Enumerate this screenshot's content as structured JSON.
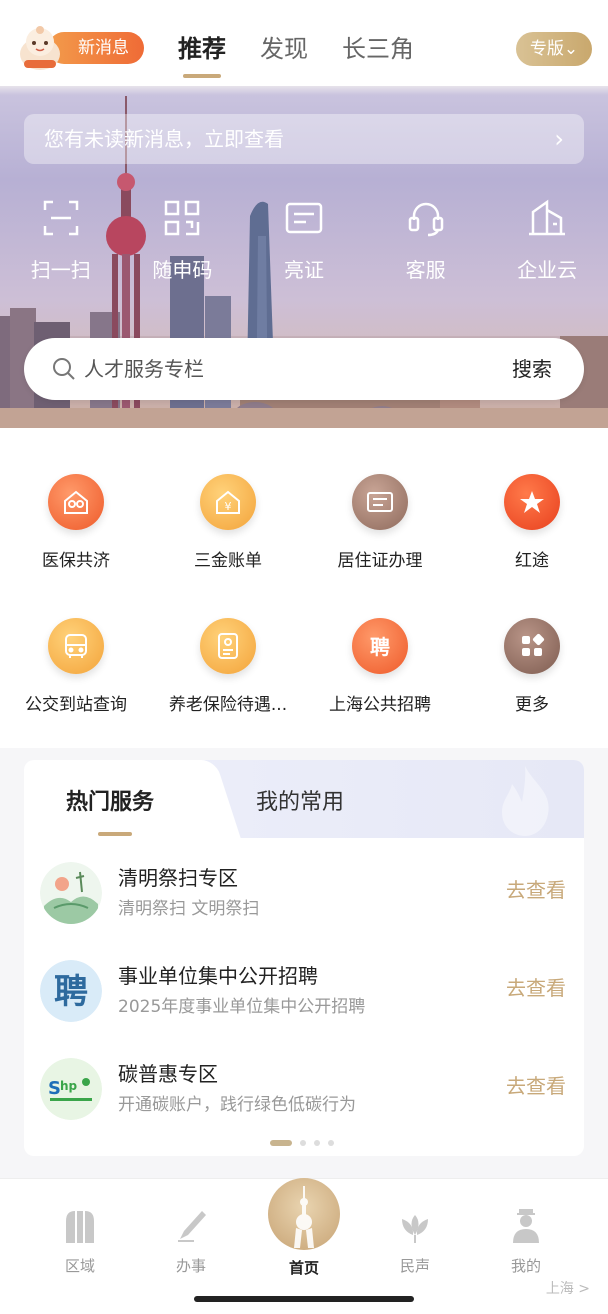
{
  "header": {
    "new_message_label": "新消息",
    "tabs": [
      {
        "label": "推荐",
        "active": true
      },
      {
        "label": "发现",
        "active": false
      },
      {
        "label": "长三角",
        "active": false
      }
    ],
    "edition_label": "专版"
  },
  "notice": {
    "text": "您有未读新消息，立即查看"
  },
  "quick_actions": [
    {
      "label": "扫一扫",
      "icon": "scan-icon"
    },
    {
      "label": "随申码",
      "icon": "qr-code-icon"
    },
    {
      "label": "亮证",
      "icon": "certificate-icon"
    },
    {
      "label": "客服",
      "icon": "headset-icon"
    },
    {
      "label": "企业云",
      "icon": "building-icon"
    }
  ],
  "search": {
    "placeholder": "人才服务专栏",
    "button_label": "搜索"
  },
  "services": [
    {
      "label": "医保共济",
      "icon": "family-icon",
      "color": "#f0693a"
    },
    {
      "label": "三金账单",
      "icon": "house-yen-icon",
      "color": "#f5a94a"
    },
    {
      "label": "居住证办理",
      "icon": "id-card-icon",
      "color": "#9e7a6a"
    },
    {
      "label": "红途",
      "icon": "star-icon",
      "color": "#ef4a2d"
    },
    {
      "label": "公交到站查询",
      "icon": "bus-icon",
      "color": "#f5a94a"
    },
    {
      "label": "养老保险待遇...",
      "icon": "document-icon",
      "color": "#f5a94a"
    },
    {
      "label": "上海公共招聘",
      "icon": "hire-icon",
      "color": "#f0693a"
    },
    {
      "label": "更多",
      "icon": "apps-icon",
      "color": "#8f6e60"
    }
  ],
  "hot_card": {
    "tab_hot": "热门服务",
    "tab_common": "我的常用",
    "items": [
      {
        "title": "清明祭扫专区",
        "subtitle": "清明祭扫 文明祭扫",
        "action": "去查看",
        "icon": "landscape-icon"
      },
      {
        "title": "事业单位集中公开招聘",
        "subtitle": "2025年度事业单位集中公开招聘",
        "action": "去查看",
        "icon": "hire-badge-icon"
      },
      {
        "title": "碳普惠专区",
        "subtitle": "开通碳账户，践行绿色低碳行为",
        "action": "去查看",
        "icon": "carbon-logo-icon"
      }
    ]
  },
  "bottom_nav": [
    {
      "label": "区域",
      "icon": "region-icon"
    },
    {
      "label": "办事",
      "icon": "pen-icon"
    },
    {
      "label": "首页",
      "icon": "tower-icon",
      "active": true
    },
    {
      "label": "民声",
      "icon": "flower-icon"
    },
    {
      "label": "我的",
      "icon": "person-icon"
    }
  ],
  "corner_text": "上海 >"
}
